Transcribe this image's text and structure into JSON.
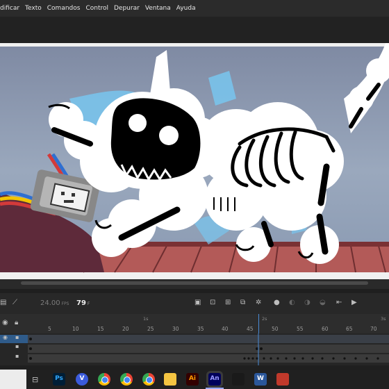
{
  "menu": {
    "items": [
      "dificar",
      "Texto",
      "Comandos",
      "Control",
      "Depurar",
      "Ventana",
      "Ayuda"
    ]
  },
  "timeline": {
    "fps_value": "24.00",
    "fps_unit": "FPS",
    "current_frame": "79",
    "frame_unit": "F",
    "ruler_seconds": [
      "1s",
      "2s",
      "3s"
    ],
    "ruler_numbers": [
      "5",
      "10",
      "15",
      "20",
      "25",
      "30",
      "35",
      "40",
      "45",
      "50",
      "55",
      "60",
      "65",
      "70"
    ]
  },
  "taskbar": {
    "apps": [
      {
        "name": "photoshop",
        "label": "Ps",
        "color": "#001e36",
        "text": "#31a8ff"
      },
      {
        "name": "vpn",
        "label": "V",
        "color": "#3b5bdb",
        "text": "#ffffff"
      },
      {
        "name": "chrome",
        "label": "",
        "color": "#ffffff",
        "text": "#ffffff"
      },
      {
        "name": "chrome-2",
        "label": "",
        "color": "#ffffff",
        "text": "#ffffff"
      },
      {
        "name": "chrome-3",
        "label": "",
        "color": "#ffffff",
        "text": "#ffffff"
      },
      {
        "name": "file-explorer",
        "label": "",
        "color": "#f5c542",
        "text": "#000000"
      },
      {
        "name": "illustrator",
        "label": "Ai",
        "color": "#330000",
        "text": "#ff9a00"
      },
      {
        "name": "animate",
        "label": "An",
        "color": "#00005b",
        "text": "#9999ff"
      },
      {
        "name": "terminal",
        "label": "",
        "color": "#1a1a1a",
        "text": "#ffffff"
      },
      {
        "name": "word",
        "label": "W",
        "color": "#2b579a",
        "text": "#ffffff"
      },
      {
        "name": "other-app",
        "label": "",
        "color": "#c0392b",
        "text": "#ffffff"
      }
    ]
  }
}
